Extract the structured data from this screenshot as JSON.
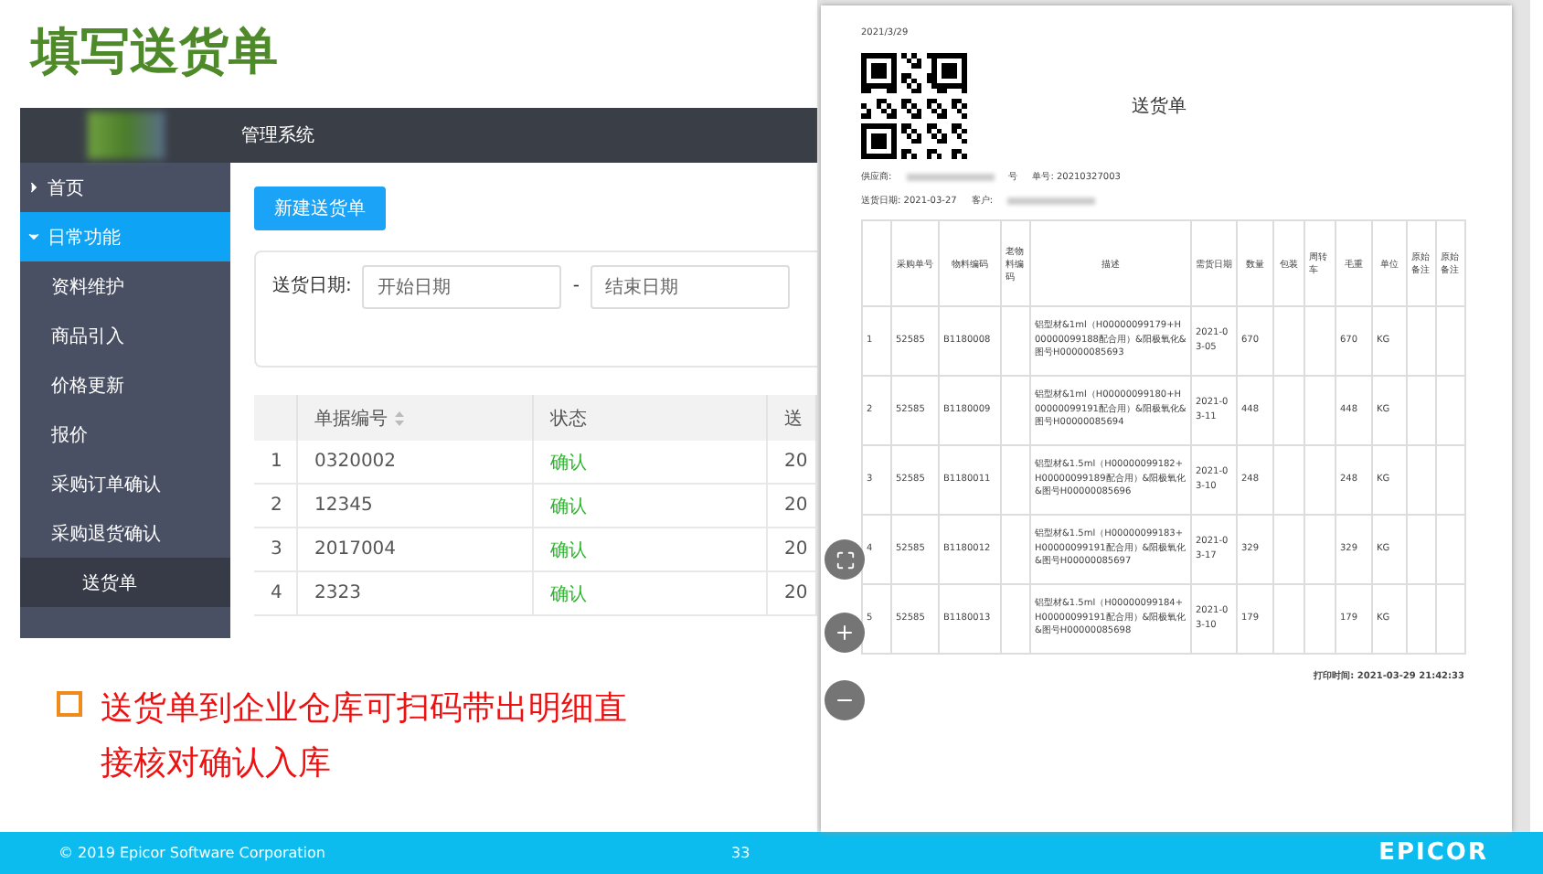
{
  "slide_title": "填写送货单",
  "app": {
    "title": "管理系统",
    "sidebar": [
      {
        "label": "首页",
        "kind": "group",
        "expanded": false,
        "selected": false
      },
      {
        "label": "日常功能",
        "kind": "group",
        "expanded": true,
        "selected": true
      },
      {
        "label": "资料维护",
        "kind": "item",
        "selected": false
      },
      {
        "label": "商品引入",
        "kind": "item",
        "selected": false
      },
      {
        "label": "价格更新",
        "kind": "item",
        "selected": false
      },
      {
        "label": "报价",
        "kind": "item",
        "selected": false
      },
      {
        "label": "采购订单确认",
        "kind": "item",
        "selected": false
      },
      {
        "label": "采购退货确认",
        "kind": "item",
        "selected": false
      },
      {
        "label": "送货单",
        "kind": "subitem",
        "selected": true
      }
    ],
    "new_button": "新建送货单",
    "filter": {
      "label": "送货日期:",
      "start_placeholder": "开始日期",
      "separator": "-",
      "end_placeholder": "结束日期"
    },
    "table": {
      "columns": [
        "单据编号",
        "状态",
        "送"
      ],
      "rows": [
        {
          "index": "1",
          "number": "0320002",
          "status": "确认",
          "column_3": "20"
        },
        {
          "index": "2",
          "number": "12345",
          "status": "确认",
          "column_3": "20"
        },
        {
          "index": "3",
          "number": "2017004",
          "status": "确认",
          "column_3": "20"
        },
        {
          "index": "4",
          "number": "2323",
          "status": "确认",
          "column_3": "20"
        }
      ]
    }
  },
  "bullet": "送货单到企业仓库可扫码带出明细直接核对确认入库",
  "document": {
    "date": "2021/3/29",
    "title": "送货单",
    "supplier_label": "供应商:",
    "supplier_suffix": "号",
    "order_no": "单号: 20210327003",
    "delivery_date": "送货日期: 2021-03-27",
    "customer_label": "客户:",
    "columns": [
      "采购单号",
      "物料编码",
      "老物料编码",
      "描述",
      "需货日期",
      "数量",
      "包装",
      "周转车",
      "毛重",
      "单位",
      "原始备注",
      "原始备注"
    ],
    "rows": [
      {
        "index": "1",
        "po": "52585",
        "material": "B1180008",
        "description": "铝型材&1ml（H00000099179+H00000099188配合用）&阳极氧化&图号H00000085693",
        "date": "2021-03-05",
        "qty": "670",
        "weight": "670",
        "unit": "KG"
      },
      {
        "index": "2",
        "po": "52585",
        "material": "B1180009",
        "description": "铝型材&1ml（H00000099180+H00000099191配合用）&阳极氧化&图号H00000085694",
        "date": "2021-03-11",
        "qty": "448",
        "weight": "448",
        "unit": "KG"
      },
      {
        "index": "3",
        "po": "52585",
        "material": "B1180011",
        "description": "铝型材&1.5ml（H00000099182+H00000099189配合用）&阳极氧化&图号H00000085696",
        "date": "2021-03-10",
        "qty": "248",
        "weight": "248",
        "unit": "KG"
      },
      {
        "index": "4",
        "po": "52585",
        "material": "B1180012",
        "description": "铝型材&1.5ml（H00000099183+H00000099191配合用）&阳极氧化&图号H00000085697",
        "date": "2021-03-17",
        "qty": "329",
        "weight": "329",
        "unit": "KG"
      },
      {
        "index": "5",
        "po": "52585",
        "material": "B1180013",
        "description": "铝型材&1.5ml（H00000099184+H00000099191配合用）&阳极氧化&图号H00000085698",
        "date": "2021-03-10",
        "qty": "179",
        "weight": "179",
        "unit": "KG"
      }
    ],
    "print_time": "打印时间: 2021-03-29 21:42:33"
  },
  "footer": {
    "copyright": "© 2019 Epicor Software Corporation",
    "page": "33",
    "logo": "EPICOR"
  }
}
